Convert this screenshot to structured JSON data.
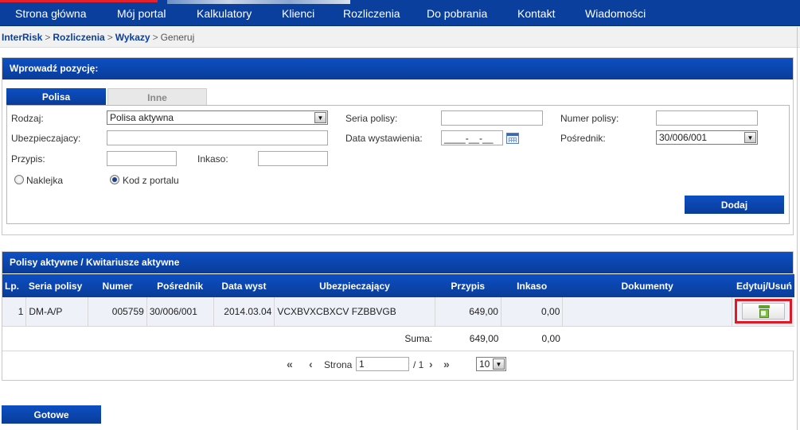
{
  "nav": {
    "items": [
      "Strona główna",
      "Mój portal",
      "Kalkulatory",
      "Klienci",
      "Rozliczenia",
      "Do pobrania",
      "Kontakt",
      "Wiadomości"
    ]
  },
  "breadcrumb": {
    "items": [
      "InterRisk",
      "Rozliczenia",
      "Wykazy"
    ],
    "current": "Generuj",
    "separator": ">"
  },
  "form_panel": {
    "title": "Wprowadź pozycję:",
    "tabs": [
      "Polisa",
      "Inne"
    ],
    "labels": {
      "rodzaj": "Rodzaj:",
      "ubezpieczajacy": "Ubezpieczajacy:",
      "przypis": "Przypis:",
      "inkaso": "Inkaso:",
      "seria": "Seria polisy:",
      "data": "Data wystawienia:",
      "numer": "Numer polisy:",
      "posrednik": "Pośrednik:"
    },
    "values": {
      "rodzaj": "Polisa aktywna",
      "ubezpieczajacy": "",
      "przypis": "",
      "inkaso": "",
      "seria": "",
      "data": "____-__-__",
      "numer": "",
      "posrednik": "30/006/001"
    },
    "radios": {
      "naklejka": "Naklejka",
      "kod": "Kod z portalu",
      "selected": "kod"
    },
    "add_button": "Dodaj"
  },
  "list_panel": {
    "title": "Polisy aktywne / Kwitariusze aktywne",
    "columns": [
      "Lp.",
      "Seria polisy",
      "Numer",
      "Pośrednik",
      "Data wyst",
      "Ubezpieczający",
      "Przypis",
      "Inkaso",
      "Dokumenty",
      "Edytuj/Usuń"
    ],
    "rows": [
      {
        "lp": "1",
        "seria": "DM-A/P",
        "numer": "005759",
        "posrednik": "30/006/001",
        "data": "2014.03.04",
        "ubezpieczajacy": "VCXBVXCBXCV FZBBVGB",
        "przypis": "649,00",
        "inkaso": "0,00",
        "dokumenty": ""
      }
    ],
    "sum": {
      "label": "Suma:",
      "przypis": "649,00",
      "inkaso": "0,00"
    },
    "pager": {
      "label": "Strona",
      "page": "1",
      "total": "/ 1",
      "page_size": "10"
    }
  },
  "done_button": "Gotowe",
  "colors": {
    "primary": "#0b3f9e",
    "highlight": "#e01a24",
    "row_bg": "#eef1f7"
  },
  "icons": {
    "edit_delete": "trash-icon",
    "calendar": "calendar-icon"
  }
}
